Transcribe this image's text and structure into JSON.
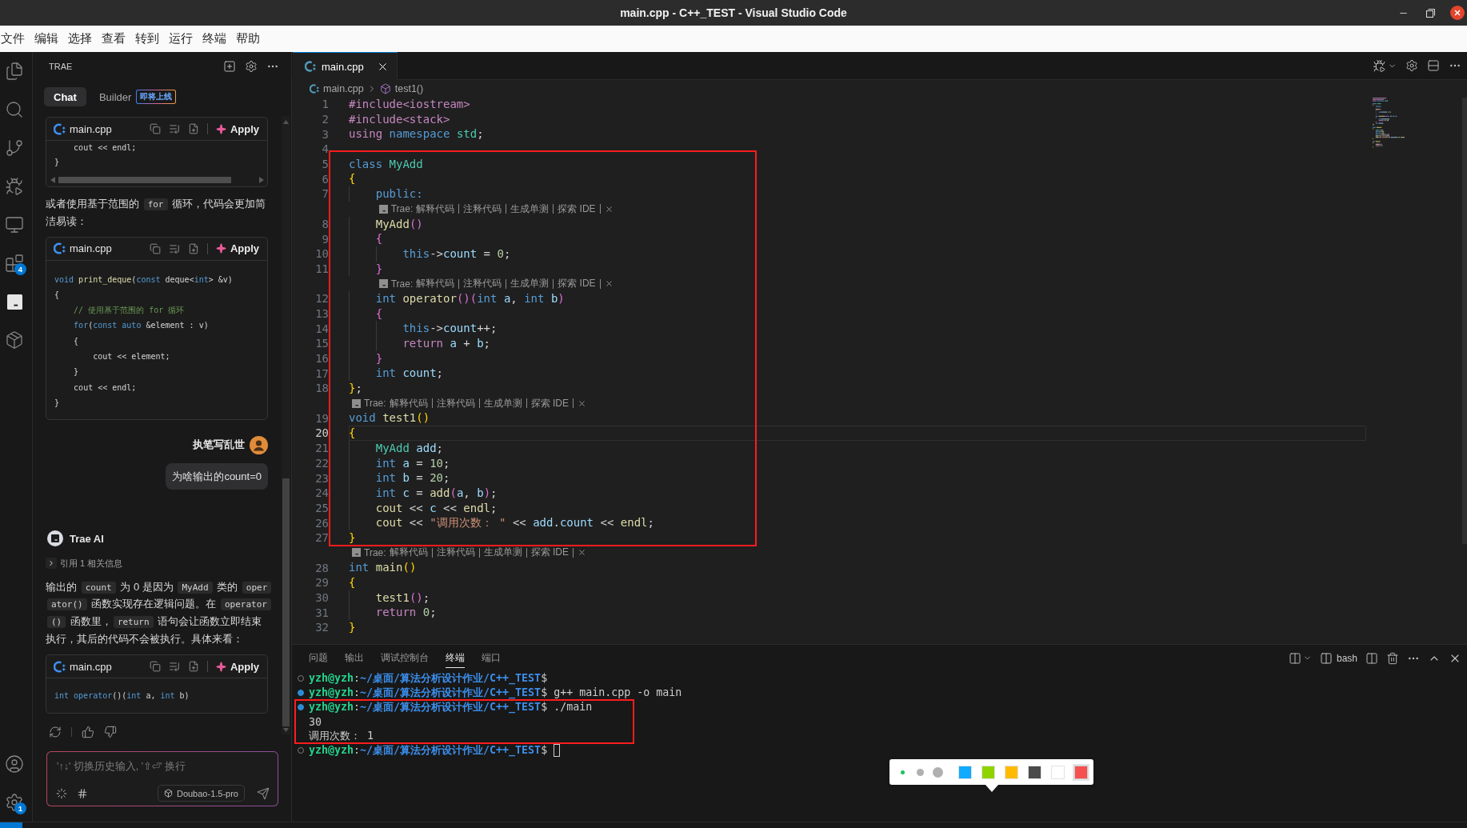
{
  "window": {
    "title": "main.cpp - C++_TEST - Visual Studio Code"
  },
  "menu": [
    "文件",
    "编辑",
    "选择",
    "查看",
    "转到",
    "运行",
    "终端",
    "帮助"
  ],
  "activity_bar": {
    "top": [
      {
        "kind": "explorer"
      },
      {
        "kind": "search"
      },
      {
        "kind": "scm"
      },
      {
        "kind": "debug"
      },
      {
        "kind": "remote"
      },
      {
        "kind": "extensions",
        "badge": "4"
      },
      {
        "kind": "trae"
      },
      {
        "kind": "containers"
      }
    ],
    "bottom": [
      {
        "kind": "account"
      },
      {
        "kind": "settings",
        "badge": "1"
      }
    ]
  },
  "chat": {
    "title": "TRAE",
    "tabs": [
      {
        "label": "Chat",
        "selected": true
      },
      {
        "label": "Builder",
        "selected": false,
        "badge": "即将上线"
      }
    ],
    "messages": [
      {
        "kind": "code",
        "file": "main.cpp",
        "action": "Apply",
        "scrollbar": true,
        "lines": [
          [
            {
              "kind": "plain",
              "text": "    cout << endl;"
            }
          ],
          [
            {
              "kind": "plain",
              "text": "}"
            }
          ]
        ]
      },
      {
        "kind": "paragraph",
        "segments": [
          {
            "kind": "text",
            "text": "或者使用基于范围的 "
          },
          {
            "kind": "code",
            "text": "for"
          },
          {
            "kind": "text",
            "text": " 循环，代码会更加简洁易读："
          }
        ]
      },
      {
        "kind": "code",
        "file": "main.cpp",
        "action": "Apply",
        "scrollbar": false,
        "lines": [
          [
            {
              "kind": "keyword",
              "text": "void"
            },
            {
              "kind": "function",
              "text": " print_deque"
            },
            {
              "kind": "plain",
              "text": "("
            },
            {
              "kind": "keyword",
              "text": "const"
            },
            {
              "kind": "plain",
              "text": " deque<"
            },
            {
              "kind": "keyword",
              "text": "int"
            },
            {
              "kind": "plain",
              "text": "> &v)"
            }
          ],
          [
            {
              "kind": "plain",
              "text": "{"
            }
          ],
          [
            {
              "kind": "comment",
              "text": "    // 使用基于范围的 for 循环"
            }
          ],
          [
            {
              "kind": "keyword",
              "text": "    for"
            },
            {
              "kind": "plain",
              "text": "("
            },
            {
              "kind": "keyword",
              "text": "const"
            },
            {
              "kind": "keyword",
              "text": " auto"
            },
            {
              "kind": "plain",
              "text": " &element : v)"
            }
          ],
          [
            {
              "kind": "plain",
              "text": "    {"
            }
          ],
          [
            {
              "kind": "plain",
              "text": "        cout << element;"
            }
          ],
          [
            {
              "kind": "plain",
              "text": "    }"
            }
          ],
          [
            {
              "kind": "plain",
              "text": "    cout << endl;"
            }
          ],
          [
            {
              "kind": "plain",
              "text": "}"
            }
          ]
        ]
      },
      {
        "kind": "user",
        "name": "执笔写乱世",
        "text": "为啥输出的count=0"
      },
      {
        "kind": "assistant",
        "name": "Trae AI"
      },
      {
        "kind": "reference",
        "text": "引用 1 相关信息",
        "expanded": false
      },
      {
        "kind": "paragraph",
        "segments": [
          {
            "kind": "text",
            "text": "输出的 "
          },
          {
            "kind": "code",
            "text": "count"
          },
          {
            "kind": "text",
            "text": " 为 0 是因为 "
          },
          {
            "kind": "code",
            "text": "MyAdd"
          },
          {
            "kind": "text",
            "text": " 类的 "
          },
          {
            "kind": "code",
            "text": "operator()"
          },
          {
            "kind": "text",
            "text": " 函数实现存在逻辑问题。在 "
          },
          {
            "kind": "code",
            "text": "operator()"
          },
          {
            "kind": "text",
            "text": " 函数里，"
          },
          {
            "kind": "code",
            "text": "return"
          },
          {
            "kind": "text",
            "text": " 语句会让函数立即结束执行，其后的代码不会被执行。具体来看："
          }
        ]
      },
      {
        "kind": "code",
        "file": "main.cpp",
        "action": "Apply",
        "scrollbar": false,
        "lines": [
          [
            {
              "kind": "keyword",
              "text": "int"
            },
            {
              "kind": "keyword",
              "text": " operator"
            },
            {
              "kind": "plain",
              "text": "()("
            },
            {
              "kind": "keyword",
              "text": "int"
            },
            {
              "kind": "plain",
              "text": " a, "
            },
            {
              "kind": "keyword",
              "text": "int"
            },
            {
              "kind": "plain",
              "text": " b)"
            }
          ]
        ]
      },
      {
        "kind": "feedback"
      }
    ],
    "input": {
      "placeholder": "'↑↓' 切换历史输入, '⇧⏎' 换行",
      "model": "Doubao-1.5-pro"
    }
  },
  "editor": {
    "tabs": [
      {
        "label": "main.cpp",
        "selected": true
      }
    ],
    "breadcrumb": [
      "main.cpp",
      "test1()"
    ],
    "lines": [
      {
        "kind": "code",
        "number": "1",
        "current": false,
        "tokens": [
          {
            "kind": "directive",
            "text": "#include<iostream>"
          }
        ]
      },
      {
        "kind": "code",
        "number": "2",
        "current": false,
        "tokens": [
          {
            "kind": "directive",
            "text": "#include<stack>"
          }
        ]
      },
      {
        "kind": "code",
        "number": "3",
        "current": false,
        "tokens": [
          {
            "kind": "control",
            "text": "using"
          },
          {
            "kind": "keyword",
            "text": " namespace"
          },
          {
            "kind": "type",
            "text": " std"
          },
          {
            "kind": "plain",
            "text": ";"
          }
        ]
      },
      {
        "kind": "code",
        "number": "4",
        "current": false
      },
      {
        "kind": "code",
        "number": "5",
        "current": false,
        "tokens": [
          {
            "kind": "keyword",
            "text": "class"
          },
          {
            "kind": "type",
            "text": " MyAdd"
          }
        ]
      },
      {
        "kind": "code",
        "number": "6",
        "current": false,
        "tokens": [
          {
            "kind": "bracket1",
            "text": "{"
          }
        ]
      },
      {
        "kind": "code",
        "number": "7",
        "current": false,
        "tokens": [
          {
            "kind": "keyword",
            "text": "    public:"
          }
        ]
      },
      {
        "kind": "codelens",
        "label": "Trae:",
        "actions": [
          "解释代码",
          "注释代码",
          "生成单测",
          "探索 IDE"
        ]
      },
      {
        "kind": "code",
        "number": "8",
        "current": false,
        "tokens": [
          {
            "kind": "function",
            "text": "    MyAdd"
          },
          {
            "kind": "bracket2",
            "text": "()"
          }
        ]
      },
      {
        "kind": "code",
        "number": "9",
        "current": false,
        "tokens": [
          {
            "kind": "bracket2",
            "text": "    {"
          }
        ]
      },
      {
        "kind": "code",
        "number": "10",
        "current": false,
        "tokens": [
          {
            "kind": "keyword",
            "text": "        this"
          },
          {
            "kind": "plain",
            "text": "->"
          },
          {
            "kind": "variable",
            "text": "count"
          },
          {
            "kind": "plain",
            "text": " = "
          },
          {
            "kind": "number",
            "text": "0"
          },
          {
            "kind": "plain",
            "text": ";"
          }
        ]
      },
      {
        "kind": "code",
        "number": "11",
        "current": false,
        "tokens": [
          {
            "kind": "bracket2",
            "text": "    }"
          }
        ]
      },
      {
        "kind": "codelens",
        "label": "Trae:",
        "actions": [
          "解释代码",
          "注释代码",
          "生成单测",
          "探索 IDE"
        ]
      },
      {
        "kind": "code",
        "number": "12",
        "current": false,
        "tokens": [
          {
            "kind": "keyword",
            "text": "    int"
          },
          {
            "kind": "function",
            "text": " operator"
          },
          {
            "kind": "bracket2",
            "text": "()("
          },
          {
            "kind": "keyword",
            "text": "int"
          },
          {
            "kind": "variable",
            "text": " a"
          },
          {
            "kind": "plain",
            "text": ", "
          },
          {
            "kind": "keyword",
            "text": "int"
          },
          {
            "kind": "variable",
            "text": " b"
          },
          {
            "kind": "bracket2",
            "text": ")"
          }
        ]
      },
      {
        "kind": "code",
        "number": "13",
        "current": false,
        "tokens": [
          {
            "kind": "bracket2",
            "text": "    {"
          }
        ]
      },
      {
        "kind": "code",
        "number": "14",
        "current": false,
        "tokens": [
          {
            "kind": "keyword",
            "text": "        this"
          },
          {
            "kind": "plain",
            "text": "->"
          },
          {
            "kind": "variable",
            "text": "count"
          },
          {
            "kind": "plain",
            "text": "++;"
          }
        ]
      },
      {
        "kind": "code",
        "number": "15",
        "current": false,
        "tokens": [
          {
            "kind": "control",
            "text": "        return"
          },
          {
            "kind": "variable",
            "text": " a"
          },
          {
            "kind": "plain",
            "text": " + "
          },
          {
            "kind": "variable",
            "text": "b"
          },
          {
            "kind": "plain",
            "text": ";"
          }
        ]
      },
      {
        "kind": "code",
        "number": "16",
        "current": false,
        "tokens": [
          {
            "kind": "bracket2",
            "text": "    }"
          }
        ]
      },
      {
        "kind": "code",
        "number": "17",
        "current": false,
        "tokens": [
          {
            "kind": "keyword",
            "text": "    int"
          },
          {
            "kind": "variable",
            "text": " count"
          },
          {
            "kind": "plain",
            "text": ";"
          }
        ]
      },
      {
        "kind": "code",
        "number": "18",
        "current": false,
        "tokens": [
          {
            "kind": "bracket1",
            "text": "}"
          },
          {
            "kind": "plain",
            "text": ";"
          }
        ]
      },
      {
        "kind": "codelens",
        "label": "Trae:",
        "actions": [
          "解释代码",
          "注释代码",
          "生成单测",
          "探索 IDE"
        ]
      },
      {
        "kind": "code",
        "number": "19",
        "current": false,
        "tokens": [
          {
            "kind": "keyword",
            "text": "void"
          },
          {
            "kind": "function",
            "text": " test1"
          },
          {
            "kind": "bracket1",
            "text": "()"
          }
        ]
      },
      {
        "kind": "code",
        "number": "20",
        "current": true,
        "tokens": [
          {
            "kind": "bracket1",
            "text": "{"
          }
        ]
      },
      {
        "kind": "code",
        "number": "21",
        "current": false,
        "tokens": [
          {
            "kind": "type",
            "text": "    MyAdd"
          },
          {
            "kind": "variable",
            "text": " add"
          },
          {
            "kind": "plain",
            "text": ";"
          }
        ]
      },
      {
        "kind": "code",
        "number": "22",
        "current": false,
        "tokens": [
          {
            "kind": "keyword",
            "text": "    int"
          },
          {
            "kind": "variable",
            "text": " a"
          },
          {
            "kind": "plain",
            "text": " = "
          },
          {
            "kind": "number",
            "text": "10"
          },
          {
            "kind": "plain",
            "text": ";"
          }
        ]
      },
      {
        "kind": "code",
        "number": "23",
        "current": false,
        "tokens": [
          {
            "kind": "keyword",
            "text": "    int"
          },
          {
            "kind": "variable",
            "text": " b"
          },
          {
            "kind": "plain",
            "text": " = "
          },
          {
            "kind": "number",
            "text": "20"
          },
          {
            "kind": "plain",
            "text": ";"
          }
        ]
      },
      {
        "kind": "code",
        "number": "24",
        "current": false,
        "tokens": [
          {
            "kind": "keyword",
            "text": "    int"
          },
          {
            "kind": "variable",
            "text": " c"
          },
          {
            "kind": "plain",
            "text": " = "
          },
          {
            "kind": "function",
            "text": "add"
          },
          {
            "kind": "bracket2",
            "text": "("
          },
          {
            "kind": "variable",
            "text": "a"
          },
          {
            "kind": "plain",
            "text": ", "
          },
          {
            "kind": "variable",
            "text": "b"
          },
          {
            "kind": "bracket2",
            "text": ")"
          },
          {
            "kind": "plain",
            "text": ";"
          }
        ]
      },
      {
        "kind": "code",
        "number": "25",
        "current": false,
        "tokens": [
          {
            "kind": "function",
            "text": "    cout"
          },
          {
            "kind": "plain",
            "text": " << "
          },
          {
            "kind": "variable",
            "text": "c"
          },
          {
            "kind": "plain",
            "text": " << "
          },
          {
            "kind": "function",
            "text": "endl"
          },
          {
            "kind": "plain",
            "text": ";"
          }
        ]
      },
      {
        "kind": "code",
        "number": "26",
        "current": false,
        "tokens": [
          {
            "kind": "function",
            "text": "    cout"
          },
          {
            "kind": "plain",
            "text": " << "
          },
          {
            "kind": "string",
            "text": "\"调用次数： \""
          },
          {
            "kind": "plain",
            "text": " << "
          },
          {
            "kind": "variable",
            "text": "add"
          },
          {
            "kind": "plain",
            "text": "."
          },
          {
            "kind": "variable",
            "text": "count"
          },
          {
            "kind": "plain",
            "text": " << "
          },
          {
            "kind": "function",
            "text": "endl"
          },
          {
            "kind": "plain",
            "text": ";"
          }
        ]
      },
      {
        "kind": "code",
        "number": "27",
        "current": false,
        "tokens": [
          {
            "kind": "bracket1",
            "text": "}"
          }
        ]
      },
      {
        "kind": "codelens",
        "label": "Trae:",
        "actions": [
          "解释代码",
          "注释代码",
          "生成单测",
          "探索 IDE"
        ]
      },
      {
        "kind": "code",
        "number": "28",
        "current": false,
        "tokens": [
          {
            "kind": "keyword",
            "text": "int"
          },
          {
            "kind": "function",
            "text": " main"
          },
          {
            "kind": "bracket1",
            "text": "()"
          }
        ]
      },
      {
        "kind": "code",
        "number": "29",
        "current": false,
        "tokens": [
          {
            "kind": "bracket1",
            "text": "{"
          }
        ]
      },
      {
        "kind": "code",
        "number": "30",
        "current": false,
        "tokens": [
          {
            "kind": "function",
            "text": "    test1"
          },
          {
            "kind": "bracket2",
            "text": "()"
          },
          {
            "kind": "plain",
            "text": ";"
          }
        ]
      },
      {
        "kind": "code",
        "number": "31",
        "current": false,
        "tokens": [
          {
            "kind": "control",
            "text": "    return"
          },
          {
            "kind": "number",
            "text": " 0"
          },
          {
            "kind": "plain",
            "text": ";"
          }
        ]
      },
      {
        "kind": "code",
        "number": "32",
        "current": false,
        "tokens": [
          {
            "kind": "bracket1",
            "text": "}"
          }
        ]
      }
    ]
  },
  "panel": {
    "tabs": [
      {
        "label": "问题",
        "selected": false
      },
      {
        "label": "输出",
        "selected": false
      },
      {
        "label": "调试控制台",
        "selected": false
      },
      {
        "label": "终端",
        "selected": true
      },
      {
        "label": "端口",
        "selected": false
      }
    ],
    "shell": "bash",
    "terminal": [
      {
        "kind": "prompt",
        "success": false,
        "user": "yzh@yzh",
        "separator": ":",
        "path": "~/桌面/算法分析设计作业/C++_TEST",
        "symbol": "$",
        "cursor": false
      },
      {
        "kind": "prompt",
        "success": true,
        "user": "yzh@yzh",
        "separator": ":",
        "path": "~/桌面/算法分析设计作业/C++_TEST",
        "symbol": "$",
        "command": "g++ main.cpp -o main",
        "cursor": false
      },
      {
        "kind": "prompt",
        "success": true,
        "user": "yzh@yzh",
        "separator": ":",
        "path": "~/桌面/算法分析设计作业/C++_TEST",
        "symbol": "$",
        "command": "./main",
        "cursor": false
      },
      {
        "kind": "output",
        "text": "30"
      },
      {
        "kind": "output",
        "text": "调用次数： 1"
      },
      {
        "kind": "prompt",
        "success": false,
        "user": "yzh@yzh",
        "separator": ":",
        "path": "~/桌面/算法分析设计作业/C++_TEST",
        "symbol": "$",
        "cursor": true
      }
    ]
  },
  "annotation_toolbar": {
    "sizes": [
      {
        "selected": true
      },
      {
        "selected": false
      },
      {
        "selected": false
      }
    ],
    "colors": [
      {
        "color": "#12aaff",
        "selected": false
      },
      {
        "color": "#8fd400",
        "selected": false
      },
      {
        "color": "#ffbb00",
        "selected": false
      },
      {
        "color": "#4b4b4b",
        "selected": false
      },
      {
        "color": "#ffffff",
        "selected": false
      },
      {
        "color": "#f65151",
        "selected": true
      }
    ]
  },
  "markup": [
    {
      "kind": "rectangle"
    },
    {
      "kind": "rectangle"
    }
  ]
}
